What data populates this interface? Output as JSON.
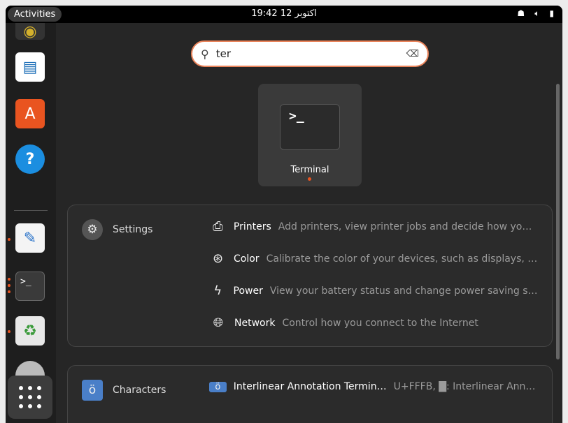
{
  "topbar": {
    "activities": "Activities",
    "clock": "19:42  12 اکتوبر",
    "tray": [
      "network-icon",
      "volume-icon",
      "battery-icon"
    ]
  },
  "dock": {
    "apps": [
      {
        "name": "Rhythmbox",
        "icon": "speaker-icon",
        "running": false
      },
      {
        "name": "LibreOffice Writer",
        "icon": "writer-icon",
        "running": false
      },
      {
        "name": "Ubuntu Software",
        "icon": "software-icon",
        "running": false
      },
      {
        "name": "Help",
        "icon": "help-icon",
        "running": false
      },
      {
        "name": "Text Editor",
        "icon": "text-editor-icon",
        "running": true
      },
      {
        "name": "Terminal",
        "icon": "terminal-icon",
        "running": true
      },
      {
        "name": "Trash",
        "icon": "trash-icon",
        "running": true
      }
    ],
    "show_apps": "show-apps-icon"
  },
  "search": {
    "value": "ter"
  },
  "app_result": {
    "label": "Terminal",
    "glyph": ">_"
  },
  "settings": {
    "provider": "Settings",
    "results": [
      {
        "title": "Printers",
        "desc": "Add printers, view printer jobs and decide how you w…",
        "icon": "printer-icon"
      },
      {
        "title": "Color",
        "desc": "Calibrate the color of your devices, such as displays, ca…",
        "icon": "color-icon"
      },
      {
        "title": "Power",
        "desc": "View your battery status and change power saving setti…",
        "icon": "power-icon"
      },
      {
        "title": "Network",
        "desc": "Control how you connect to the Internet",
        "icon": "globe-icon"
      }
    ]
  },
  "characters": {
    "provider": "Characters",
    "results": [
      {
        "title": "Interlinear Annotation Termin…",
        "desc": "U+FFFB, █: Interlinear Annot…",
        "icon": "characters-icon"
      }
    ]
  },
  "colors": {
    "accent": "#e95420"
  }
}
